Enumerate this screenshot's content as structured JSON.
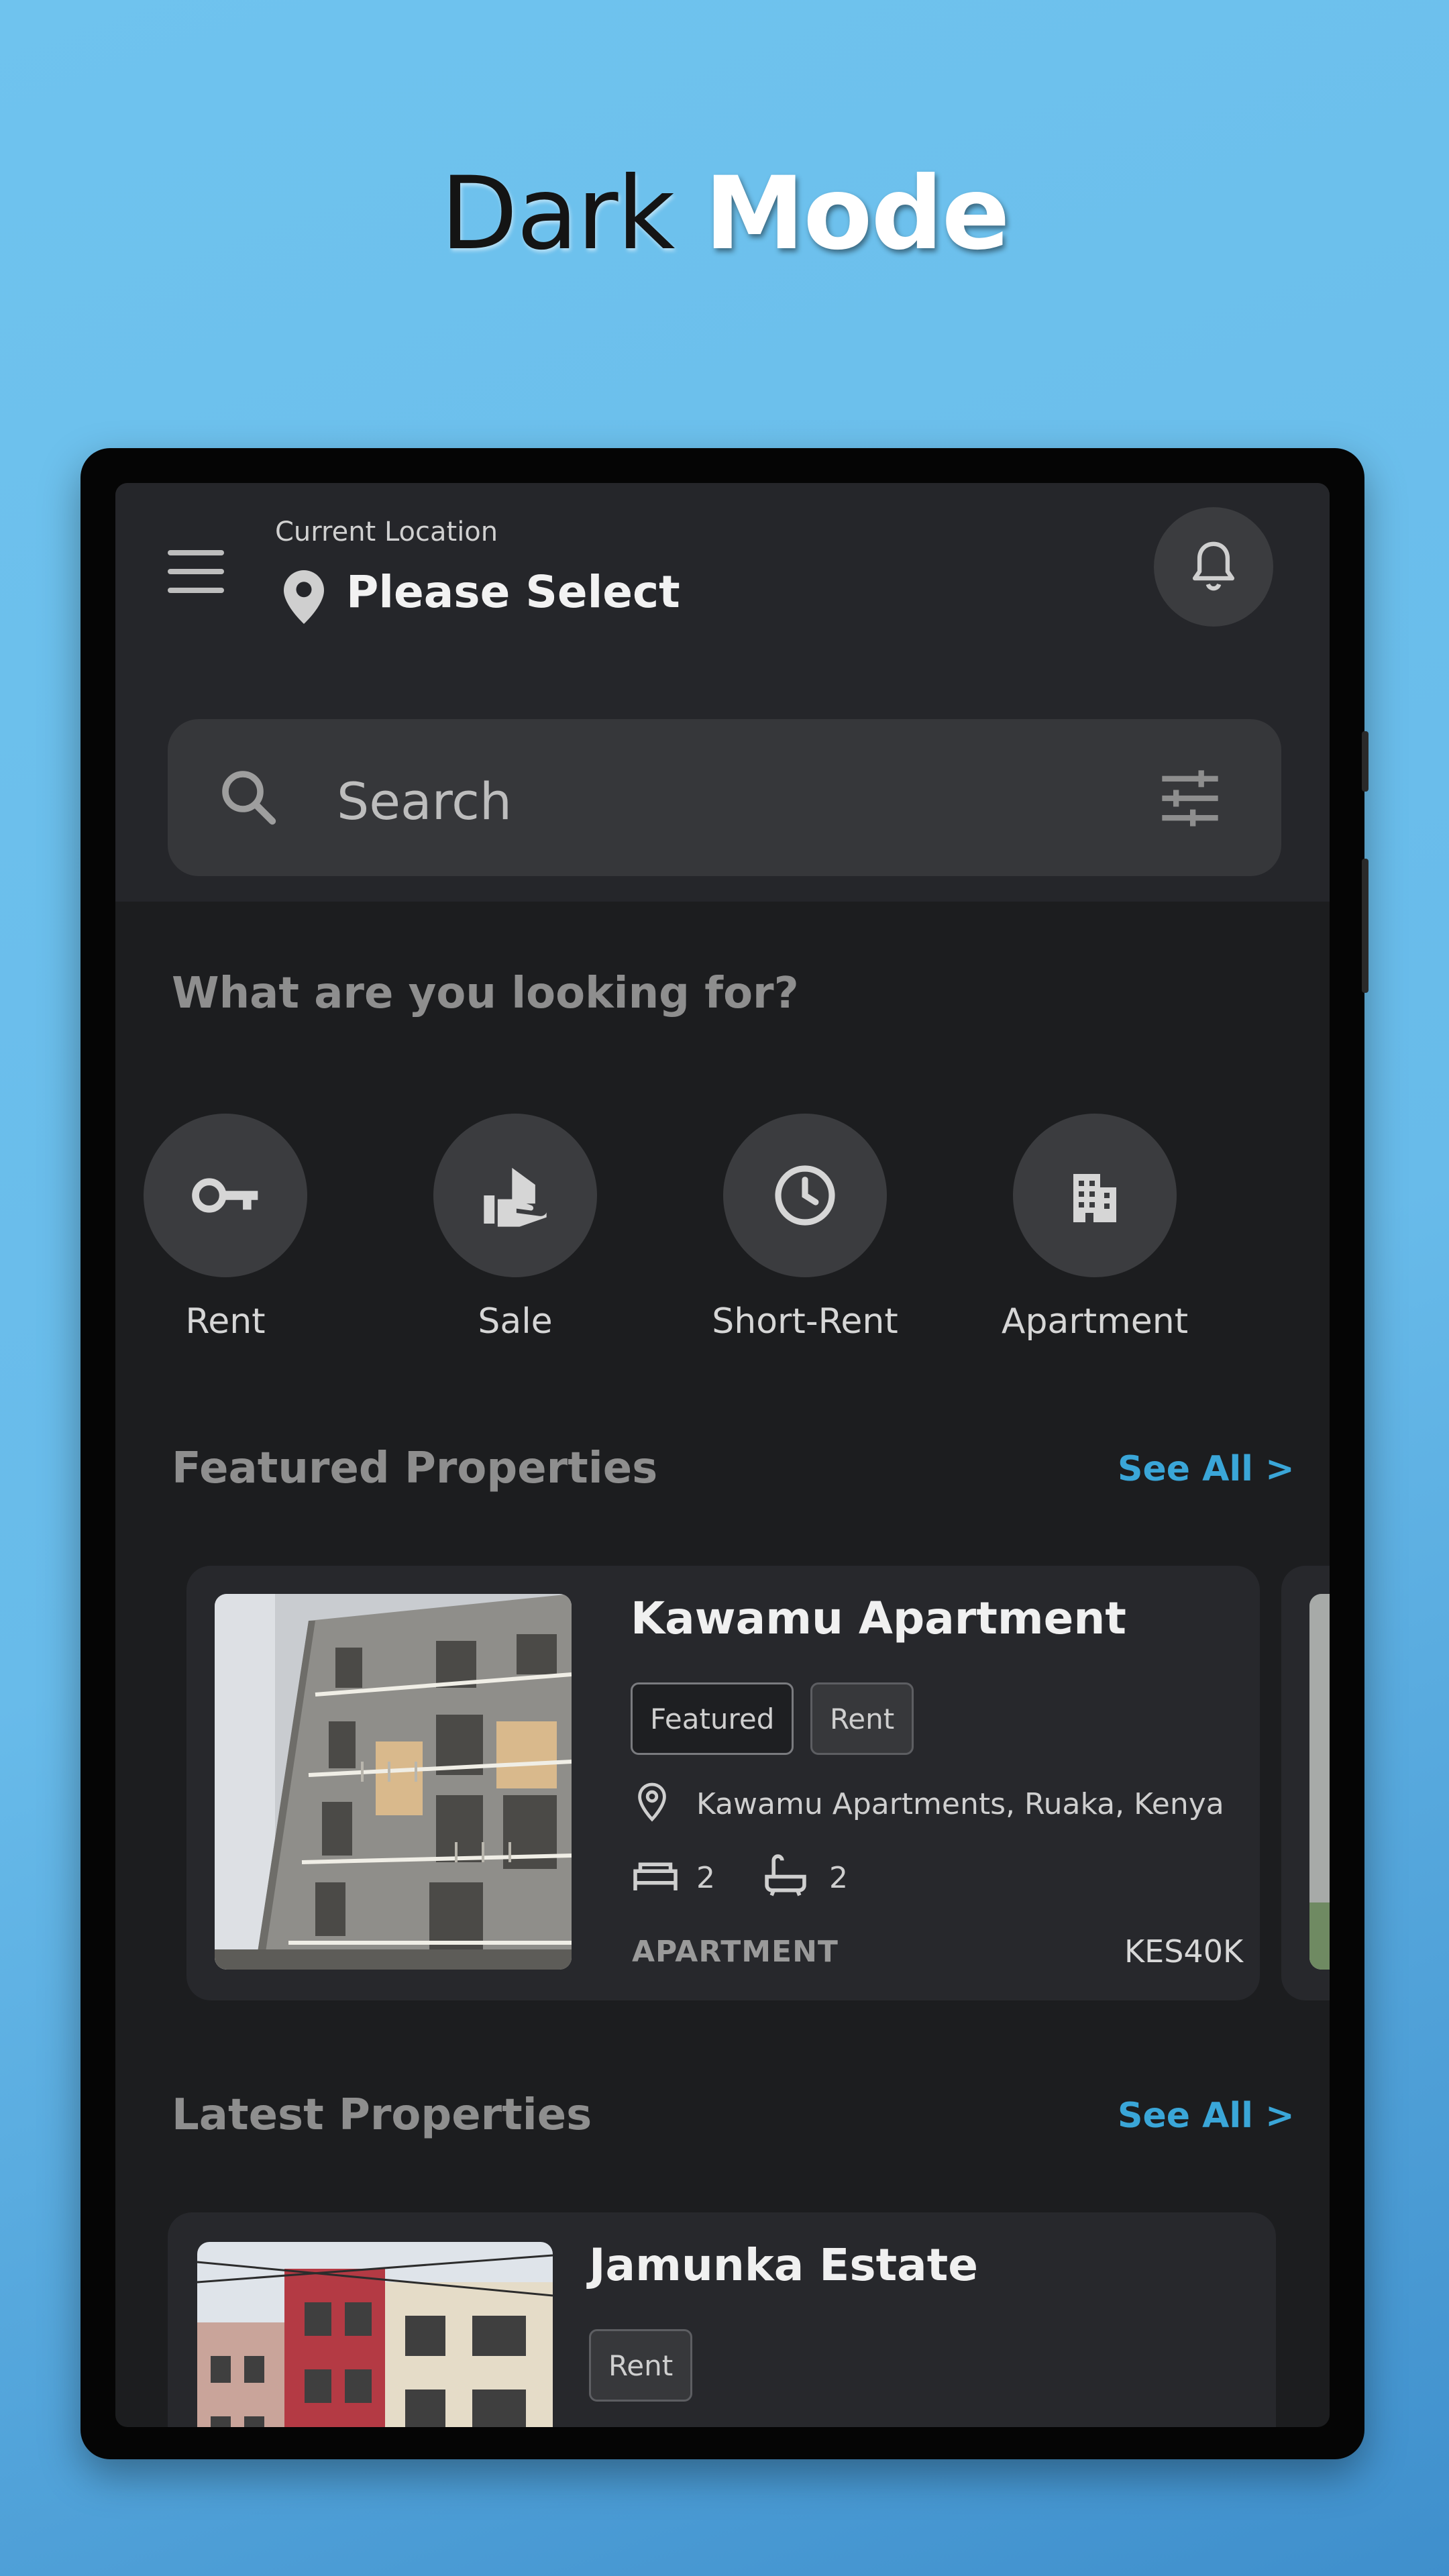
{
  "headline": {
    "word1": "Dark",
    "word2": "Mode"
  },
  "header": {
    "location_caption": "Current Location",
    "location_value": "Please Select"
  },
  "search": {
    "placeholder": "Search"
  },
  "categories_section": {
    "title": "What are you looking for?",
    "items": [
      {
        "label": "Rent",
        "icon": "key-icon"
      },
      {
        "label": "Sale",
        "icon": "house-hand-icon"
      },
      {
        "label": "Short-Rent",
        "icon": "clock-icon"
      },
      {
        "label": "Apartment",
        "icon": "apartment-building-icon"
      }
    ]
  },
  "featured": {
    "title": "Featured Properties",
    "see_all": "See All >",
    "cards": [
      {
        "name": "Kawamu Apartment",
        "tags": [
          "Featured",
          "Rent"
        ],
        "location": "Kawamu Apartments, Ruaka, Kenya",
        "beds": "2",
        "baths": "2",
        "type": "APARTMENT",
        "price": "KES40K"
      }
    ]
  },
  "latest": {
    "title": "Latest Properties",
    "see_all": "See All >",
    "cards": [
      {
        "name": "Jamunka Estate",
        "tags": [
          "Rent"
        ]
      }
    ]
  },
  "colors": {
    "background": "#6fc3ee",
    "screen": "#1c1d1f",
    "topbar": "#25262a",
    "card": "#27282c",
    "accent": "#3aa6d8"
  }
}
